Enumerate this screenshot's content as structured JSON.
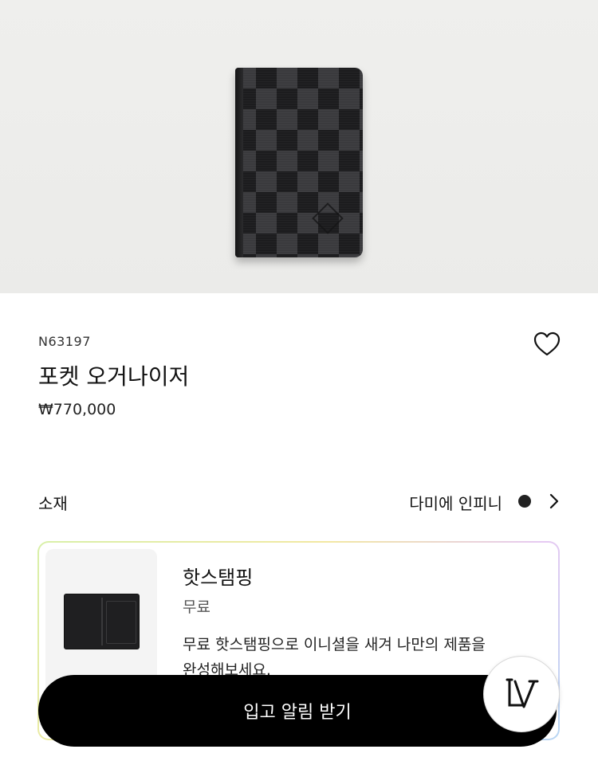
{
  "product": {
    "sku": "N63197",
    "title": "포켓 오거나이저",
    "price": "₩770,000"
  },
  "material": {
    "label": "소재",
    "value": "다미에 인피니",
    "swatch_color": "#222222"
  },
  "option_card": {
    "title": "핫스탬핑",
    "price": "무료",
    "description": "무료 핫스탬핑으로 이니셜을 새겨 나만의 제품을 완성해보세요."
  },
  "cta": {
    "label": "입고 알림 받기"
  },
  "icons": {
    "wishlist": "heart-icon",
    "material_next": "chevron-right-icon",
    "brand": "lv-logo-icon"
  },
  "colors": {
    "button_bg": "#000000",
    "button_text": "#ffffff"
  }
}
